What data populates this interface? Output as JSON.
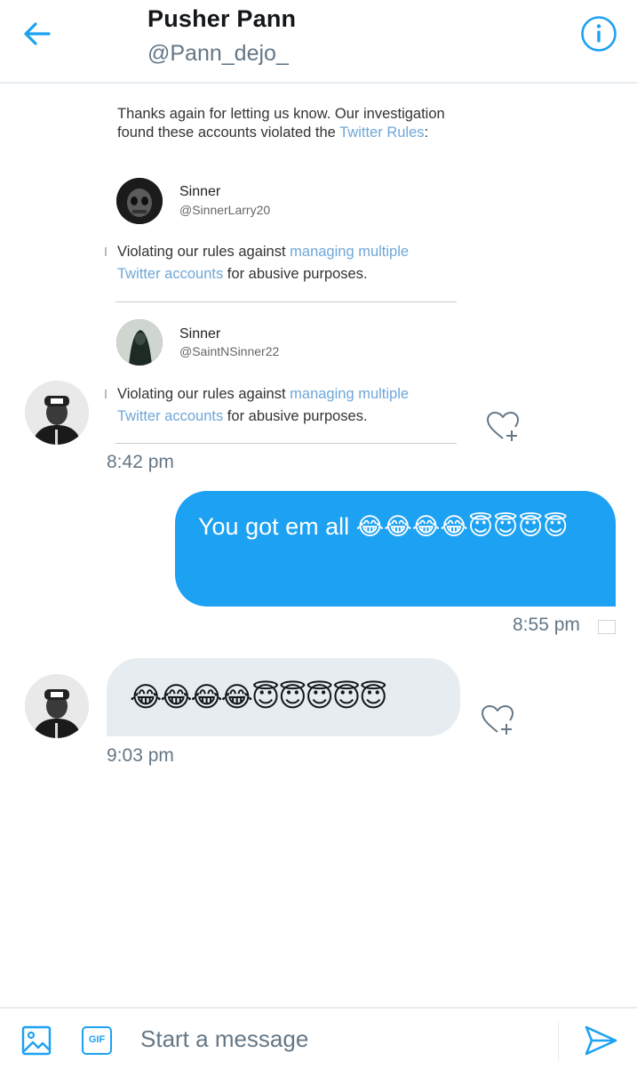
{
  "header": {
    "title": "Pusher Pann",
    "handle": "@Pann_dejo_",
    "back_icon": "arrow-left-icon",
    "info_icon": "info-icon",
    "accent_color": "#1da1f2"
  },
  "conversation": {
    "screenshot_message": {
      "intro_text": "Thanks again for letting us know. Our investigation found these accounts violated the ",
      "intro_link": "Twitter Rules",
      "intro_suffix": ":",
      "accounts": [
        {
          "name": "Sinner",
          "handle": "@SinnerLarry20",
          "violation_prefix": "Violating our rules against ",
          "violation_link": "managing multiple Twitter accounts",
          "violation_suffix": " for abusive purposes."
        },
        {
          "name": "Sinner",
          "handle": "@SaintNSinner22",
          "violation_prefix": "Violating our rules against ",
          "violation_link": "managing multiple Twitter accounts",
          "violation_suffix": " for abusive purposes."
        }
      ],
      "time": "8:42 pm"
    },
    "sent_message": {
      "text": "You got em all 😂😂😂😂😇😇😇😇",
      "time": "8:55 pm"
    },
    "received_message": {
      "text": "😂😂😂😂😇😇😇😇😇",
      "time": "9:03 pm"
    }
  },
  "composer": {
    "placeholder": "Start a message",
    "gif_label": "GIF",
    "image_icon": "image-icon",
    "send_icon": "send-icon"
  }
}
